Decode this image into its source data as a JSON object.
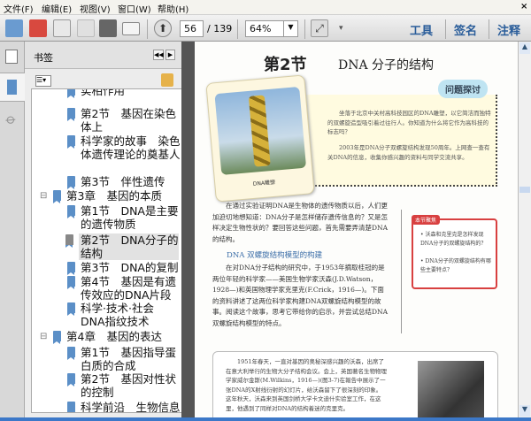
{
  "menu": [
    "文件(F)",
    "编辑(E)",
    "视图(V)",
    "窗口(W)",
    "帮助(H)"
  ],
  "menu_close": "×",
  "toolbar": {
    "page_current": "56",
    "page_total": "/ 139",
    "zoom": "64%",
    "tools": "工具",
    "sign": "签名",
    "comment": "注释"
  },
  "bookmarks": {
    "title": "书签",
    "items": [
      {
        "text": "实相作用",
        "level": 2
      },
      {
        "text": "第2节　基因在染色体上",
        "level": 2
      },
      {
        "text": "科学家的故事　染色体遗传理论的奠基人",
        "level": 2
      },
      {
        "text": "第3节　伴性遗传",
        "level": 2
      },
      {
        "text": "第3章　基因的本质",
        "level": 1
      },
      {
        "text": "第1节　DNA是主要的遗传物质",
        "level": 2
      },
      {
        "text": "第2节　DNA分子的结构",
        "level": 2,
        "selected": true
      },
      {
        "text": "第3节　DNA的复制",
        "level": 2
      },
      {
        "text": "第4节　基因是有遗传效应的DNA片段",
        "level": 2
      },
      {
        "text": "科学·技术·社会 DNA指纹技术",
        "level": 2
      },
      {
        "text": "第4章　基因的表达",
        "level": 1
      },
      {
        "text": "第1节　基因指导蛋白质的合成",
        "level": 2
      },
      {
        "text": "第2节　基因对性状的控制",
        "level": 2
      },
      {
        "text": "科学前沿　生物信息学",
        "level": 2
      }
    ]
  },
  "doc": {
    "title_num": "第2节",
    "title": "DNA 分子的结构",
    "photo_caption": "DNA雕塑",
    "discuss_tag": "问题探讨",
    "discuss_p1": "坐落于北京中关村高科技园区的DNA雕塑，以它简洁而独特的双螺旋造型吸引着过往行人。你知道为什么将它作为高科技的标志吗？",
    "discuss_p2": "2003年是DNA分子双螺旋结构发现50周年。上网查一查有关DNA的信息，收集你感兴趣的资料与同学交流共享。",
    "intro": "在通过实验证明DNA是生物体的遗传物质以后，人们更加迫切地想知道：DNA分子是怎样储存遗传信息的？又是怎样决定生物性状的？要回答这些问题，首先需要弄清楚DNA的结构。",
    "section_head": "DNA 双螺旋结构模型的构建",
    "para2": "在对DNA分子结构的研究中，于1953年摘取桂冠的是两位年轻的科学家——美国生物学家沃森(J.D.Watson，1928—)和英国物理学家克里克(F.Crick，1916—)。下面的资料讲述了这两位科学家构建DNA双螺旋结构模型的故事。阅读这个故事，思考它带给你的启示，并尝试总结DNA双螺旋结构模型的特点。",
    "sidebar_tag": "本节聚焦",
    "focus": [
      "沃森和克里克是怎样发现DNA分子的双螺旋结构的？",
      "DNA分子的双螺旋结构有哪些主要特点？"
    ],
    "story": "1951年春天，一直对基因的奥秘深感兴趣的沃森，出席了在意大利举行的生物大分子结构会议。会上，英国著名生物物理学家威尔金斯(M.Wilkins，1916—)(图3-7)在報告中展示了一张DNA的X射线衍射的幻灯片，给沃森留下了很深刻的印象。这年秋天，沃森来到英国剑桥大学卡文迪什实验室工作，在这里，他遇到了同样对DNA的结构着迷的克里克。"
  }
}
